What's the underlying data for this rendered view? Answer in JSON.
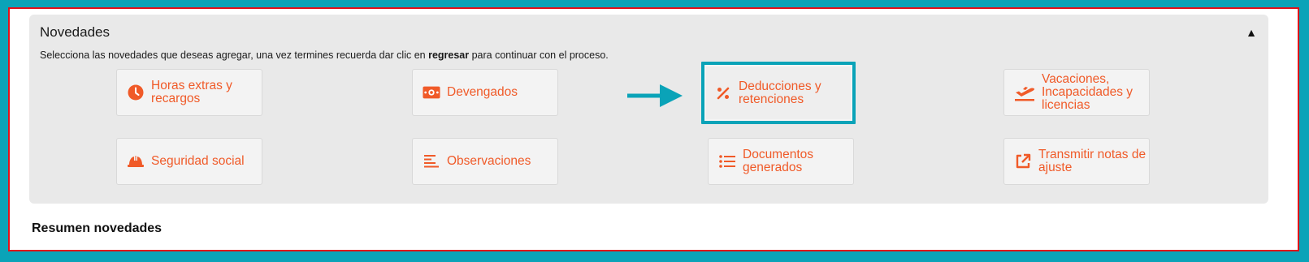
{
  "panel": {
    "title": "Novedades",
    "description_pre": "Selecciona las novedades que deseas agregar, una vez termines recuerda dar clic en ",
    "description_bold": "regresar",
    "description_post": " para continuar con el proceso.",
    "toggle": "▲"
  },
  "cards": [
    {
      "label": "Horas extras y recargos",
      "icon": "clock-icon"
    },
    {
      "label": "Devengados",
      "icon": "money-bill-icon"
    },
    {
      "label": "Deducciones y retenciones",
      "icon": "percent-icon",
      "highlighted": true
    },
    {
      "label": "Vacaciones, Incapacidades y licencias",
      "icon": "plane-departure-icon"
    },
    {
      "label": "Seguridad social",
      "icon": "hard-hat-icon"
    },
    {
      "label": "Observaciones",
      "icon": "align-left-icon"
    },
    {
      "label": "Documentos generados",
      "icon": "list-icon"
    },
    {
      "label": "Transmitir notas de ajuste",
      "icon": "external-link-icon"
    }
  ],
  "summary": {
    "title": "Resumen novedades"
  },
  "colors": {
    "accent": "#f05a28",
    "highlight": "#0aa3b8",
    "frame_border": "#e0101a",
    "panel_bg": "#e9e9e9"
  }
}
